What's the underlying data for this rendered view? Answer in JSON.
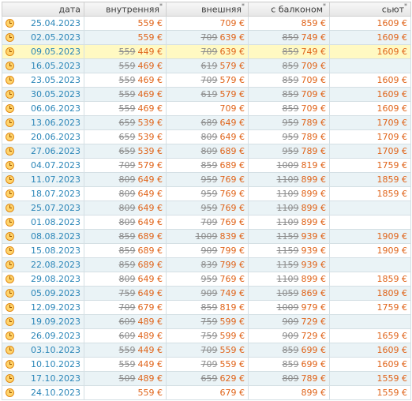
{
  "headers": [
    {
      "label": "дата",
      "star": ""
    },
    {
      "label": "внутренняя",
      "star": "*"
    },
    {
      "label": "внешняя",
      "star": "*"
    },
    {
      "label": "с балконом",
      "star": "*"
    },
    {
      "label": "сьют",
      "star": "*"
    }
  ],
  "rows": [
    {
      "date": "25.04.2023",
      "c1": {
        "old": "",
        "new": "559 €"
      },
      "c2": {
        "old": "",
        "new": "709 €"
      },
      "c3": {
        "old": "",
        "new": "859 €"
      },
      "c4": {
        "old": "",
        "new": "1609 €"
      }
    },
    {
      "date": "02.05.2023",
      "c1": {
        "old": "",
        "new": "559 €"
      },
      "c2": {
        "old": "709",
        "new": "639 €"
      },
      "c3": {
        "old": "859",
        "new": "749 €"
      },
      "c4": {
        "old": "",
        "new": "1609 €"
      }
    },
    {
      "date": "09.05.2023",
      "highlight": true,
      "c1": {
        "old": "559",
        "new": "449 €"
      },
      "c2": {
        "old": "709",
        "new": "639 €"
      },
      "c3": {
        "old": "859",
        "new": "749 €"
      },
      "c4": {
        "old": "",
        "new": "1609 €"
      }
    },
    {
      "date": "16.05.2023",
      "c1": {
        "old": "559",
        "new": "469 €"
      },
      "c2": {
        "old": "619",
        "new": "579 €"
      },
      "c3": {
        "old": "859",
        "new": "709 €"
      },
      "c4": {
        "old": "",
        "new": ""
      }
    },
    {
      "date": "23.05.2023",
      "c1": {
        "old": "559",
        "new": "469 €"
      },
      "c2": {
        "old": "709",
        "new": "579 €"
      },
      "c3": {
        "old": "859",
        "new": "709 €"
      },
      "c4": {
        "old": "",
        "new": "1609 €"
      }
    },
    {
      "date": "30.05.2023",
      "c1": {
        "old": "559",
        "new": "469 €"
      },
      "c2": {
        "old": "619",
        "new": "579 €"
      },
      "c3": {
        "old": "859",
        "new": "709 €"
      },
      "c4": {
        "old": "",
        "new": "1609 €"
      }
    },
    {
      "date": "06.06.2023",
      "c1": {
        "old": "559",
        "new": "469 €"
      },
      "c2": {
        "old": "",
        "new": "709 €"
      },
      "c3": {
        "old": "859",
        "new": "709 €"
      },
      "c4": {
        "old": "",
        "new": "1609 €"
      }
    },
    {
      "date": "13.06.2023",
      "c1": {
        "old": "659",
        "new": "539 €"
      },
      "c2": {
        "old": "689",
        "new": "649 €"
      },
      "c3": {
        "old": "959",
        "new": "789 €"
      },
      "c4": {
        "old": "",
        "new": "1709 €"
      }
    },
    {
      "date": "20.06.2023",
      "c1": {
        "old": "659",
        "new": "539 €"
      },
      "c2": {
        "old": "809",
        "new": "649 €"
      },
      "c3": {
        "old": "959",
        "new": "789 €"
      },
      "c4": {
        "old": "",
        "new": "1709 €"
      }
    },
    {
      "date": "27.06.2023",
      "c1": {
        "old": "659",
        "new": "539 €"
      },
      "c2": {
        "old": "809",
        "new": "689 €"
      },
      "c3": {
        "old": "959",
        "new": "789 €"
      },
      "c4": {
        "old": "",
        "new": "1709 €"
      }
    },
    {
      "date": "04.07.2023",
      "c1": {
        "old": "709",
        "new": "579 €"
      },
      "c2": {
        "old": "859",
        "new": "689 €"
      },
      "c3": {
        "old": "1009",
        "new": "819 €"
      },
      "c4": {
        "old": "",
        "new": "1759 €"
      }
    },
    {
      "date": "11.07.2023",
      "c1": {
        "old": "809",
        "new": "649 €"
      },
      "c2": {
        "old": "959",
        "new": "769 €"
      },
      "c3": {
        "old": "1109",
        "new": "899 €"
      },
      "c4": {
        "old": "",
        "new": "1859 €"
      }
    },
    {
      "date": "18.07.2023",
      "c1": {
        "old": "809",
        "new": "649 €"
      },
      "c2": {
        "old": "959",
        "new": "769 €"
      },
      "c3": {
        "old": "1109",
        "new": "899 €"
      },
      "c4": {
        "old": "",
        "new": "1859 €"
      }
    },
    {
      "date": "25.07.2023",
      "c1": {
        "old": "809",
        "new": "649 €"
      },
      "c2": {
        "old": "959",
        "new": "769 €"
      },
      "c3": {
        "old": "1109",
        "new": "899 €"
      },
      "c4": {
        "old": "",
        "new": ""
      }
    },
    {
      "date": "01.08.2023",
      "c1": {
        "old": "809",
        "new": "649 €"
      },
      "c2": {
        "old": "709",
        "new": "769 €"
      },
      "c3": {
        "old": "1109",
        "new": "899 €"
      },
      "c4": {
        "old": "",
        "new": ""
      }
    },
    {
      "date": "08.08.2023",
      "c1": {
        "old": "859",
        "new": "689 €"
      },
      "c2": {
        "old": "1009",
        "new": "839 €"
      },
      "c3": {
        "old": "1159",
        "new": "939 €"
      },
      "c4": {
        "old": "",
        "new": "1909 €"
      }
    },
    {
      "date": "15.08.2023",
      "c1": {
        "old": "859",
        "new": "689 €"
      },
      "c2": {
        "old": "909",
        "new": "799 €"
      },
      "c3": {
        "old": "1159",
        "new": "939 €"
      },
      "c4": {
        "old": "",
        "new": "1909 €"
      }
    },
    {
      "date": "22.08.2023",
      "c1": {
        "old": "859",
        "new": "689 €"
      },
      "c2": {
        "old": "839",
        "new": "799 €"
      },
      "c3": {
        "old": "1159",
        "new": "939 €"
      },
      "c4": {
        "old": "",
        "new": ""
      }
    },
    {
      "date": "29.08.2023",
      "c1": {
        "old": "809",
        "new": "649 €"
      },
      "c2": {
        "old": "959",
        "new": "769 €"
      },
      "c3": {
        "old": "1109",
        "new": "899 €"
      },
      "c4": {
        "old": "",
        "new": "1859 €"
      }
    },
    {
      "date": "05.09.2023",
      "c1": {
        "old": "759",
        "new": "649 €"
      },
      "c2": {
        "old": "909",
        "new": "749 €"
      },
      "c3": {
        "old": "1059",
        "new": "869 €"
      },
      "c4": {
        "old": "",
        "new": "1809 €"
      }
    },
    {
      "date": "12.09.2023",
      "c1": {
        "old": "709",
        "new": "679 €"
      },
      "c2": {
        "old": "859",
        "new": "819 €"
      },
      "c3": {
        "old": "1009",
        "new": "979 €"
      },
      "c4": {
        "old": "",
        "new": "1759 €"
      }
    },
    {
      "date": "19.09.2023",
      "c1": {
        "old": "609",
        "new": "489 €"
      },
      "c2": {
        "old": "759",
        "new": "599 €"
      },
      "c3": {
        "old": "909",
        "new": "729 €"
      },
      "c4": {
        "old": "",
        "new": ""
      }
    },
    {
      "date": "26.09.2023",
      "c1": {
        "old": "609",
        "new": "489 €"
      },
      "c2": {
        "old": "759",
        "new": "599 €"
      },
      "c3": {
        "old": "909",
        "new": "729 €"
      },
      "c4": {
        "old": "",
        "new": "1659 €"
      }
    },
    {
      "date": "03.10.2023",
      "c1": {
        "old": "559",
        "new": "449 €"
      },
      "c2": {
        "old": "709",
        "new": "559 €"
      },
      "c3": {
        "old": "859",
        "new": "699 €"
      },
      "c4": {
        "old": "",
        "new": "1609 €"
      }
    },
    {
      "date": "10.10.2023",
      "c1": {
        "old": "559",
        "new": "449 €"
      },
      "c2": {
        "old": "709",
        "new": "559 €"
      },
      "c3": {
        "old": "859",
        "new": "699 €"
      },
      "c4": {
        "old": "",
        "new": "1609 €"
      }
    },
    {
      "date": "17.10.2023",
      "c1": {
        "old": "509",
        "new": "489 €"
      },
      "c2": {
        "old": "659",
        "new": "629 €"
      },
      "c3": {
        "old": "809",
        "new": "789 €"
      },
      "c4": {
        "old": "",
        "new": "1559 €"
      }
    },
    {
      "date": "24.10.2023",
      "c1": {
        "old": "",
        "new": "559 €"
      },
      "c2": {
        "old": "",
        "new": "679 €"
      },
      "c3": {
        "old": "",
        "new": "899 €"
      },
      "c4": {
        "old": "",
        "new": "1559 €"
      }
    }
  ],
  "icon": "clock-icon",
  "colors": {
    "date": "#2b86b8",
    "price_new": "#e0641a",
    "price_old": "#8c8c8c",
    "row_alt": "#eaf3f6",
    "row_highlight": "#fff9c2"
  }
}
